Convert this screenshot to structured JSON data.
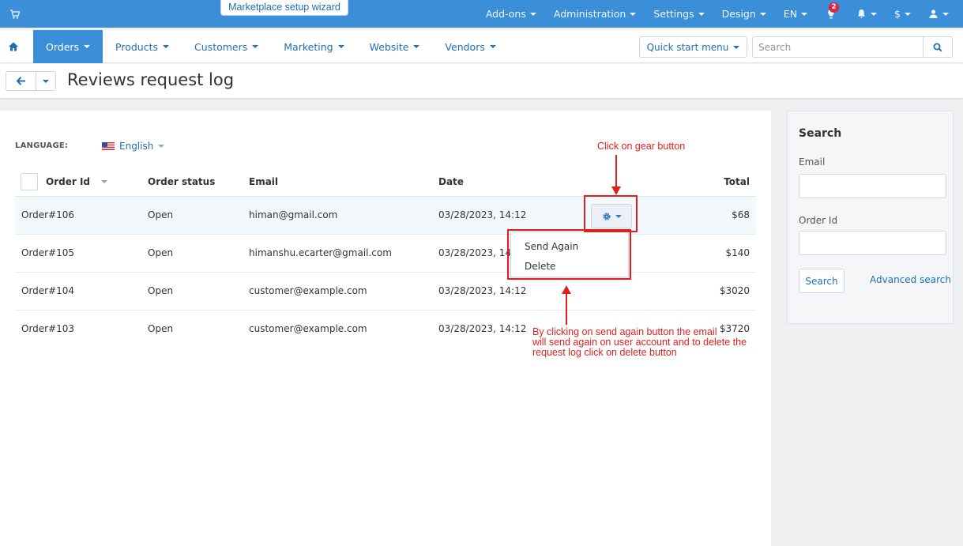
{
  "topbar": {
    "wizard_label": "Marketplace setup wizard",
    "menu": [
      {
        "label": "Add-ons"
      },
      {
        "label": "Administration"
      },
      {
        "label": "Settings"
      },
      {
        "label": "Design"
      },
      {
        "label": "EN"
      }
    ],
    "notifications_count": "2",
    "currency": "$"
  },
  "navbar": {
    "tabs": [
      {
        "label": "Orders",
        "active": true
      },
      {
        "label": "Products"
      },
      {
        "label": "Customers"
      },
      {
        "label": "Marketing"
      },
      {
        "label": "Website"
      },
      {
        "label": "Vendors"
      }
    ],
    "quick_start_label": "Quick start menu",
    "search_placeholder": "Search"
  },
  "page": {
    "title": "Reviews request log"
  },
  "language": {
    "label": "LANGUAGE:",
    "value": "English"
  },
  "table": {
    "columns": [
      "Order Id",
      "Order status",
      "Email",
      "Date",
      "Total"
    ],
    "rows": [
      {
        "order_id": "Order#106",
        "status": "Open",
        "email": "himan@gmail.com",
        "date": "03/28/2023, 14:12",
        "total": "$68"
      },
      {
        "order_id": "Order#105",
        "status": "Open",
        "email": "himanshu.ecarter@gmail.com",
        "date": "03/28/2023, 14",
        "total": "$140"
      },
      {
        "order_id": "Order#104",
        "status": "Open",
        "email": "customer@example.com",
        "date": "03/28/2023, 14:12",
        "total": "$3020"
      },
      {
        "order_id": "Order#103",
        "status": "Open",
        "email": "customer@example.com",
        "date": "03/28/2023, 14:12",
        "total": "$3720"
      }
    ]
  },
  "dropdown": {
    "items": [
      "Send Again",
      "Delete"
    ]
  },
  "annotations": {
    "gear_hint": "Click on gear button",
    "info_lines": [
      "By clicking on send again button the email",
      "will send again on user account and to delete the",
      "request log click on delete button"
    ]
  },
  "sidebar": {
    "title": "Search",
    "email_label": "Email",
    "order_id_label": "Order Id",
    "search_button": "Search",
    "advanced_link": "Advanced search"
  },
  "colors": {
    "primary": "#3b8fd8",
    "link": "#1f6fb5",
    "annotation": "#e0201d",
    "badge": "#e0263c"
  }
}
